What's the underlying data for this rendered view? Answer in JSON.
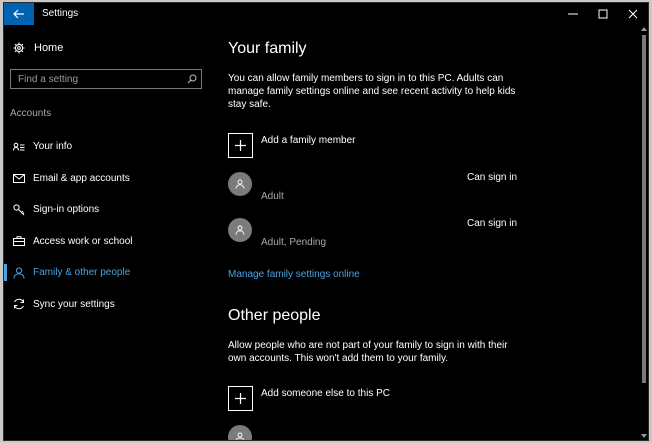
{
  "titlebar": {
    "title": "Settings",
    "back_icon": "arrow-left-icon",
    "minimize_icon": "minimize-icon",
    "maximize_icon": "maximize-icon",
    "close_icon": "close-icon",
    "accent": "#0063b1"
  },
  "sidebar": {
    "home_label": "Home",
    "search_placeholder": "Find a setting",
    "section_label": "Accounts",
    "active_color": "#4aa3df",
    "items": [
      {
        "label": "Your info",
        "icon": "person-card-icon"
      },
      {
        "label": "Email & app accounts",
        "icon": "mail-icon"
      },
      {
        "label": "Sign-in options",
        "icon": "key-icon"
      },
      {
        "label": "Access work or school",
        "icon": "briefcase-icon"
      },
      {
        "label": "Family & other people",
        "icon": "person-icon",
        "active": true
      },
      {
        "label": "Sync your settings",
        "icon": "sync-icon"
      }
    ]
  },
  "main": {
    "family": {
      "title": "Your family",
      "description": "You can allow family members to sign in to this PC. Adults can manage family settings online and see recent activity to help kids stay safe.",
      "add_label": "Add a family member",
      "members": [
        {
          "role": "Adult",
          "status": "Can sign in"
        },
        {
          "role": "Adult, Pending",
          "status": "Can sign in"
        }
      ],
      "manage_link": "Manage family settings online"
    },
    "other": {
      "title": "Other people",
      "description": "Allow people who are not part of your family to sign in with their own accounts. This won't add them to your family.",
      "add_label": "Add someone else to this PC"
    }
  }
}
